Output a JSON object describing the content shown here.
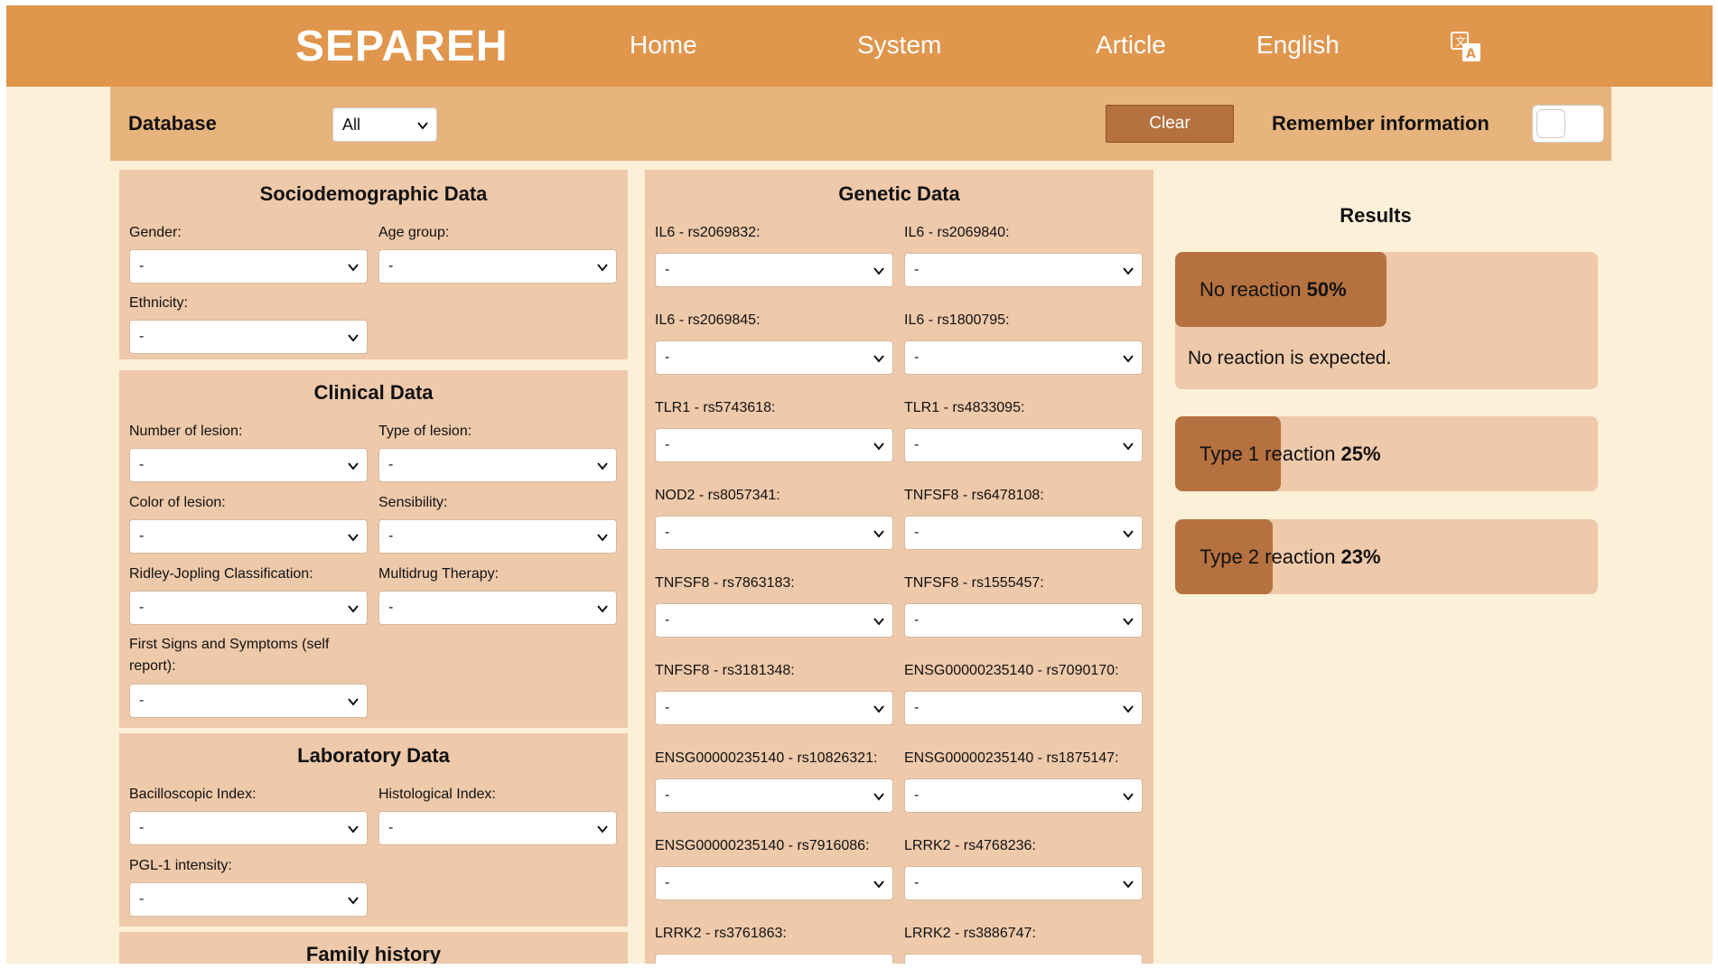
{
  "nav": {
    "brand": "SEPAREH",
    "home": "Home",
    "system": "System",
    "article": "Article",
    "language": "English",
    "translate_icon": "translate-icon"
  },
  "toolbar": {
    "database_label": "Database",
    "database_value": "All",
    "clear_label": "Clear",
    "remember_label": "Remember information",
    "remember_on": false
  },
  "socio": {
    "title": "Sociodemographic Data",
    "gender": {
      "label": "Gender:",
      "value": "-"
    },
    "age": {
      "label": "Age group:",
      "value": "-"
    },
    "ethnicity": {
      "label": "Ethnicity:",
      "value": "-"
    }
  },
  "clinical": {
    "title": "Clinical Data",
    "num_lesion": {
      "label": "Number of lesion:",
      "value": "-"
    },
    "type_lesion": {
      "label": "Type of lesion:",
      "value": "-"
    },
    "color_lesion": {
      "label": "Color of lesion:",
      "value": "-"
    },
    "sensibility": {
      "label": "Sensibility:",
      "value": "-"
    },
    "ridley": {
      "label": "Ridley-Jopling Classification:",
      "value": "-"
    },
    "mdt": {
      "label": "Multidrug Therapy:",
      "value": "-"
    },
    "first_signs_1": "First Signs and Symptoms (self",
    "first_signs_2": "report):",
    "first_signs_value": "-"
  },
  "lab": {
    "title": "Laboratory Data",
    "bacil": {
      "label": "Bacilloscopic Index:",
      "value": "-"
    },
    "histo": {
      "label": "Histological Index:",
      "value": "-"
    },
    "pgl": {
      "label": "PGL-1 intensity:",
      "value": "-"
    }
  },
  "family": {
    "title": "Family history"
  },
  "genetic": {
    "title": "Genetic Data",
    "fields": [
      {
        "label": "IL6 - rs2069832:",
        "value": "-"
      },
      {
        "label": "IL6 - rs2069840:",
        "value": "-"
      },
      {
        "label": "IL6 - rs2069845:",
        "value": "-"
      },
      {
        "label": "IL6 - rs1800795:",
        "value": "-"
      },
      {
        "label": "TLR1 - rs5743618:",
        "value": "-"
      },
      {
        "label": "TLR1 - rs4833095:",
        "value": "-"
      },
      {
        "label": "NOD2 - rs8057341:",
        "value": "-"
      },
      {
        "label": "TNFSF8 - rs6478108:",
        "value": "-"
      },
      {
        "label": "TNFSF8 - rs7863183:",
        "value": "-"
      },
      {
        "label": "TNFSF8 - rs1555457:",
        "value": "-"
      },
      {
        "label": "TNFSF8 - rs3181348:",
        "value": "-"
      },
      {
        "label": "ENSG00000235140 - rs7090170:",
        "value": "-"
      },
      {
        "label": "ENSG00000235140 - rs10826321:",
        "value": "-"
      },
      {
        "label": "ENSG00000235140 - rs1875147:",
        "value": "-"
      },
      {
        "label": "ENSG00000235140 - rs7916086:",
        "value": "-"
      },
      {
        "label": "LRRK2 - rs4768236:",
        "value": "-"
      },
      {
        "label": "LRRK2 - rs3761863:",
        "value": "-"
      },
      {
        "label": "LRRK2 - rs3886747:",
        "value": "-"
      }
    ]
  },
  "results": {
    "title": "Results",
    "items": [
      {
        "label": "No reaction ",
        "pct": "50%",
        "fraction": 0.5,
        "desc": "No reaction is expected."
      },
      {
        "label": "Type 1 reaction ",
        "pct": "25%",
        "fraction": 0.25
      },
      {
        "label": "Type 2 reaction ",
        "pct": "23%",
        "fraction": 0.23
      }
    ]
  },
  "colors": {
    "navbar": "#e0964d",
    "toolbar": "#e8b47d",
    "panel": "#eec9aa",
    "accent": "#b5713f",
    "page_bg": "#fcf0d8"
  }
}
